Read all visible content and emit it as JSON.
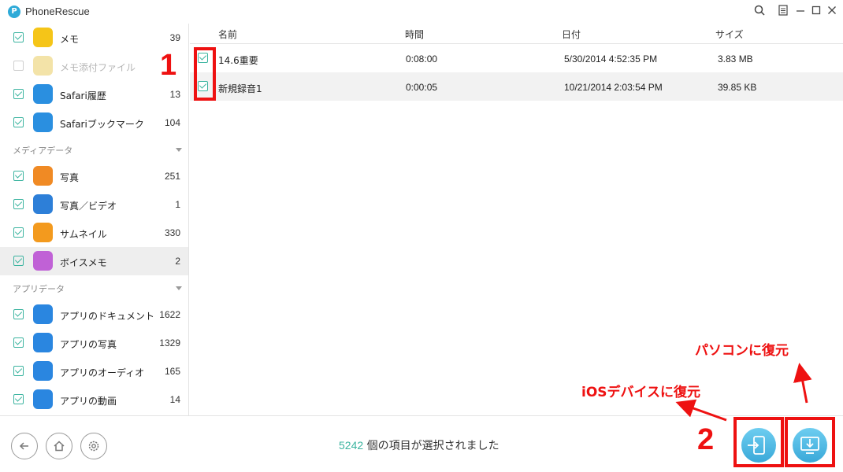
{
  "window": {
    "title": "PhoneRescue",
    "logo_letter": "P"
  },
  "sidebar": {
    "items_top": [
      {
        "label": "メモ",
        "count": "39",
        "checked": true,
        "icon": "notes-icon",
        "color": "#f5c518"
      },
      {
        "label": "メモ添付ファイル",
        "count": "",
        "checked": false,
        "icon": "notes-attachment-icon",
        "color": "#f3e3a8"
      },
      {
        "label": "Safari履歴",
        "count": "13",
        "checked": true,
        "icon": "safari-history-icon",
        "color": "#2a8fe0"
      },
      {
        "label": "Safariブックマーク",
        "count": "104",
        "checked": true,
        "icon": "safari-bookmark-icon",
        "color": "#2a8fe0"
      }
    ],
    "section_media": "メディアデータ",
    "items_media": [
      {
        "label": "写真",
        "count": "251",
        "checked": true,
        "icon": "photos-icon",
        "color": "#f08a24"
      },
      {
        "label": "写真／ビデオ",
        "count": "1",
        "checked": true,
        "icon": "photo-video-icon",
        "color": "#2d7fd8"
      },
      {
        "label": "サムネイル",
        "count": "330",
        "checked": true,
        "icon": "thumbnail-icon",
        "color": "#f39a1e"
      },
      {
        "label": "ボイスメモ",
        "count": "2",
        "checked": true,
        "icon": "voice-memo-icon",
        "color": "#c061d6",
        "active": true
      }
    ],
    "section_app": "アプリデータ",
    "items_app": [
      {
        "label": "アプリのドキュメント",
        "count": "1622",
        "checked": true,
        "icon": "app-document-icon",
        "color": "#2a86e0"
      },
      {
        "label": "アプリの写真",
        "count": "1329",
        "checked": true,
        "icon": "app-photo-icon",
        "color": "#2a86e0"
      },
      {
        "label": "アプリのオーディオ",
        "count": "165",
        "checked": true,
        "icon": "app-audio-icon",
        "color": "#2a86e0"
      },
      {
        "label": "アプリの動画",
        "count": "14",
        "checked": true,
        "icon": "app-video-icon",
        "color": "#2a86e0"
      }
    ]
  },
  "table": {
    "headers": {
      "name": "名前",
      "time": "時間",
      "date": "日付",
      "size": "サイズ"
    },
    "rows": [
      {
        "name": "14.6重要",
        "time": "0:08:00",
        "date": "5/30/2014 4:52:35 PM",
        "size": "3.83 MB"
      },
      {
        "name": "新規録音1",
        "time": "0:00:05",
        "date": "10/21/2014 2:03:54 PM",
        "size": "39.85 KB"
      }
    ]
  },
  "status": {
    "count": "5242",
    "text": " 個の項目が選択されました"
  },
  "annotations": {
    "num1": "1",
    "num2": "2",
    "ios_restore": "iOSデバイスに復元",
    "pc_restore": "パソコンに復元"
  },
  "colors": {
    "accent": "#3cb4a0",
    "annotation": "#ee1111",
    "restore_button": "#3aa9d9"
  }
}
